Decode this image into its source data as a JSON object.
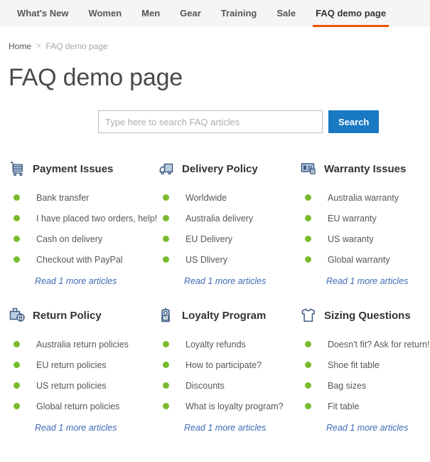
{
  "nav": {
    "items": [
      {
        "label": "What's New",
        "active": false
      },
      {
        "label": "Women",
        "active": false
      },
      {
        "label": "Men",
        "active": false
      },
      {
        "label": "Gear",
        "active": false
      },
      {
        "label": "Training",
        "active": false
      },
      {
        "label": "Sale",
        "active": false
      },
      {
        "label": "FAQ demo page",
        "active": true
      }
    ],
    "active_underline_color": "#eb5202"
  },
  "breadcrumb": {
    "home": "Home",
    "separator": ">",
    "current": "FAQ demo page"
  },
  "page": {
    "title": "FAQ demo page"
  },
  "search": {
    "placeholder": "Type here to search FAQ articles",
    "value": "",
    "button_label": "Search",
    "button_color": "#1979c3"
  },
  "colors": {
    "bullet_green": "#79bb2c",
    "link_blue": "#3f6bb5",
    "text_gray": "#575757",
    "navbar_bg": "#f5f5f5"
  },
  "categories": [
    {
      "title": "Payment Issues",
      "icon": "shopping-cart-icon",
      "articles": [
        "Bank transfer",
        "I have placed two orders, help!",
        "Cash on delivery",
        "Checkout with PayPal"
      ],
      "more_label": "Read 1 more articles"
    },
    {
      "title": "Delivery Policy",
      "icon": "delivery-truck-icon",
      "articles": [
        "Worldwide",
        "Australia delivery",
        "EU Delivery",
        "US Dlivery"
      ],
      "more_label": "Read 1 more articles"
    },
    {
      "title": "Warranty Issues",
      "icon": "warranty-card-icon",
      "articles": [
        "Australia warranty",
        "EU warranty",
        "US waranty",
        "Global warranty"
      ],
      "more_label": "Read 1 more articles"
    },
    {
      "title": "Return Policy",
      "icon": "return-box-globe-icon",
      "articles": [
        "Australia return policies",
        "EU return policies",
        "US return policies",
        "Global return policies"
      ],
      "more_label": "Read 1 more articles"
    },
    {
      "title": "Loyalty Program",
      "icon": "discount-tag-icon",
      "articles": [
        "Loyalty refunds",
        "How to participate?",
        "Discounts",
        "What is loyalty program?"
      ],
      "more_label": "Read 1 more articles"
    },
    {
      "title": "Sizing Questions",
      "icon": "tshirt-icon",
      "articles": [
        "Doesn't fit? Ask for return!",
        "Shoe fit table",
        "Bag sizes",
        "Fit table"
      ],
      "more_label": "Read 1 more articles"
    }
  ]
}
